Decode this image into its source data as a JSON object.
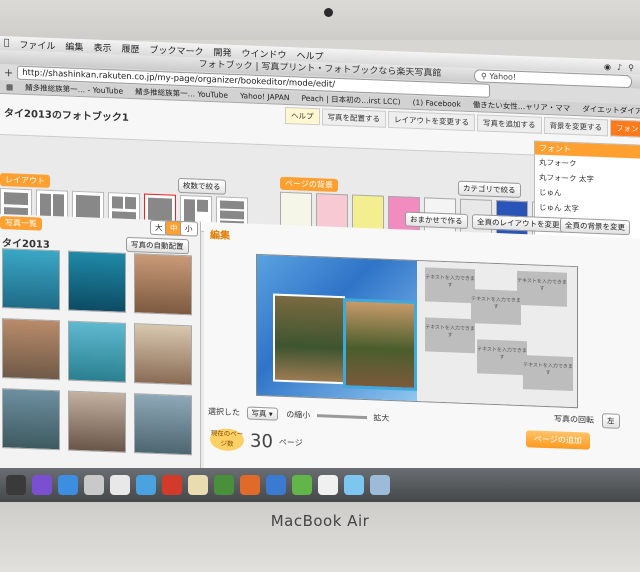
{
  "menubar": {
    "items": [
      "ファイル",
      "編集",
      "表示",
      "履歴",
      "ブックマーク",
      "開発",
      "ウインドウ",
      "ヘルプ"
    ]
  },
  "browser": {
    "title": "フォトブック | 写真プリント・フォトブックなら楽天写真館",
    "search_value": "Yahoo!",
    "address": "http://shashinkan.rakuten.co.jp/my-page/organizer/bookeditor/mode/edit/",
    "bookmarks": [
      "鯖多推総族第一… - YouTube",
      "鯖多推総族第一… YouTube",
      "Yahoo! JAPAN",
      "Peach | 日本初の…irst LCC)",
      "(1) Facebook",
      "働きたい女性…ャリア・ママ",
      "ダイエットダイア… BEAUTY"
    ]
  },
  "app": {
    "title": "タイ2013のフォトブック1",
    "tabs": [
      "ヘルプ",
      "写真を配置する",
      "レイアウトを変更する",
      "写真を追加する",
      "背景を変更する",
      "フォント名を変更"
    ],
    "layout_label": "レイアウト",
    "layout_filter": "枚数で絞る",
    "background_label": "ページの背景",
    "background_filter": "カテゴリで絞る",
    "font_label": "フォント",
    "fonts": [
      "丸フォーク",
      "丸フォーク 太字",
      "じゅん",
      "じゅん 太字"
    ],
    "auto_buttons": [
      "おまかせで作る",
      "全頁のレイアウトを変更",
      "全頁の背景を変更"
    ],
    "photo_list_label": "写真一覧",
    "album_name": "タイ2013",
    "auto_place_button": "写真の自動配置",
    "size_buttons": [
      "大",
      "中",
      "小"
    ],
    "edit_label": "編集",
    "rotate_label": "写真の回転",
    "rotate_button": "左",
    "selected_label": "選択した",
    "selected_value": "写真",
    "zoom_out_label": "の縮小",
    "zoom_in_label": "拡大",
    "page_count_caption": "現在のページ数",
    "page_count": "30",
    "page_unit": "ページ",
    "add_page_button": "ページの追加",
    "note_text": "テキストを入力できます"
  },
  "laptop": {
    "brand": "MacBook Air"
  }
}
